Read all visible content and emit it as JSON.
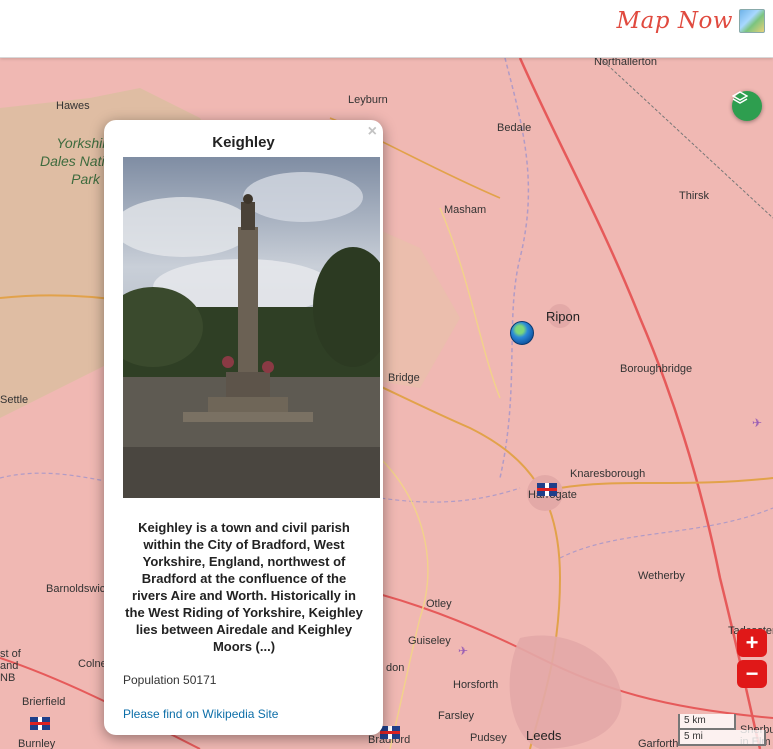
{
  "brand": {
    "title": "Map Now",
    "logo_icon": "map-logo-icon",
    "color": "#e04a3f"
  },
  "map": {
    "land_color": "#f0b8b3",
    "park_label": [
      "Yorkshire",
      "Dales National",
      "Park"
    ],
    "places": [
      {
        "id": "northallerton",
        "name": "Northallerton"
      },
      {
        "id": "hawes",
        "name": "Hawes"
      },
      {
        "id": "leyburn",
        "name": "Leyburn"
      },
      {
        "id": "bedale",
        "name": "Bedale"
      },
      {
        "id": "thirsk",
        "name": "Thirsk"
      },
      {
        "id": "masham",
        "name": "Masham"
      },
      {
        "id": "ripon",
        "name": "Ripon"
      },
      {
        "id": "bridge",
        "name": "Bridge"
      },
      {
        "id": "boroughbridge",
        "name": "Boroughbridge"
      },
      {
        "id": "settle",
        "name": "Settle"
      },
      {
        "id": "knaresborough",
        "name": "Knaresborough"
      },
      {
        "id": "harrogate",
        "name": "Harrogate"
      },
      {
        "id": "barnoldswick",
        "name": "Barnoldswic"
      },
      {
        "id": "wetherby",
        "name": "Wetherby"
      },
      {
        "id": "otley",
        "name": "Otley"
      },
      {
        "id": "guiseley",
        "name": "Guiseley"
      },
      {
        "id": "colne",
        "name": "Colne"
      },
      {
        "id": "horsforth",
        "name": "Horsforth"
      },
      {
        "id": "brierfield",
        "name": "Brierfield"
      },
      {
        "id": "farsley",
        "name": "Farsley"
      },
      {
        "id": "pudsey",
        "name": "Pudsey"
      },
      {
        "id": "leeds",
        "name": "Leeds"
      },
      {
        "id": "bradford",
        "name": "Bradford"
      },
      {
        "id": "burnley",
        "name": "Burnley"
      },
      {
        "id": "garforth",
        "name": "Garforth"
      },
      {
        "id": "tadcaster",
        "name": "Tadcaster"
      },
      {
        "id": "don",
        "name": "don"
      },
      {
        "id": "st_of",
        "name": "st of"
      },
      {
        "id": "and",
        "name": "and"
      },
      {
        "id": "nb",
        "name": "NB"
      },
      {
        "id": "sherburn",
        "name": "Sherbu"
      },
      {
        "id": "in_elmet",
        "name": "in Elm"
      }
    ],
    "scale": {
      "km": "5 km",
      "mi": "5 mi"
    },
    "zoom_in": "+",
    "zoom_out": "−"
  },
  "popup": {
    "title": "Keighley",
    "close": "×",
    "description": "Keighley is a town and civil parish within the City of Bradford, West Yorkshire, England, northwest of Bradford at the confluence of the rivers Aire and Worth. Historically in the West Riding of Yorkshire, Keighley lies between Airedale and Keighley Moors (...)",
    "population": "Population 50171",
    "link": "Please find on Wikipedia Site"
  }
}
